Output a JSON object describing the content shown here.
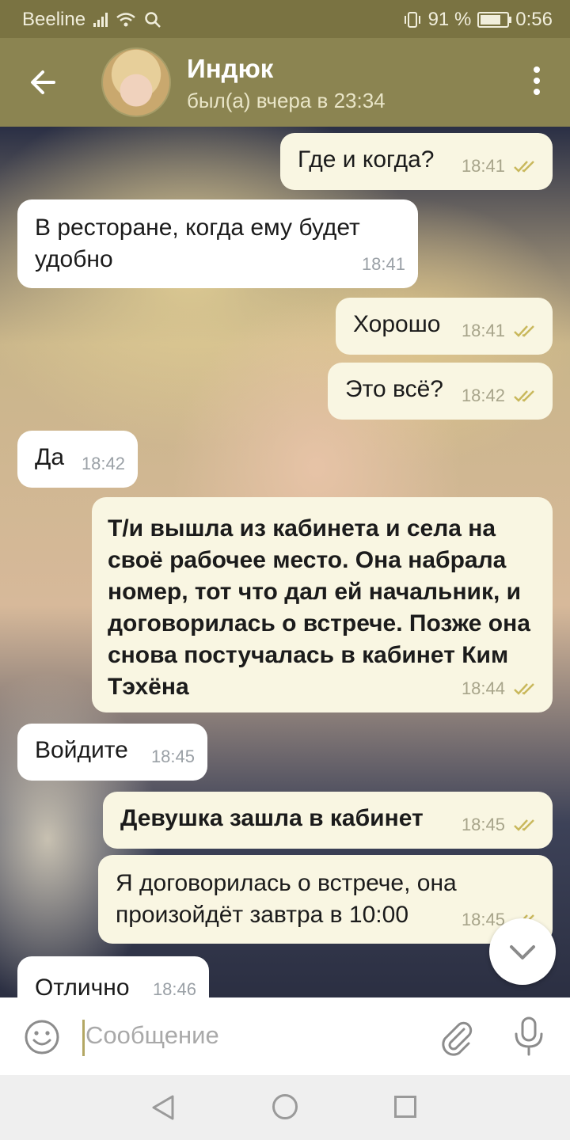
{
  "status_bar": {
    "carrier": "Beeline",
    "battery_percent": "91 %",
    "battery_level": 0.91,
    "time": "0:56"
  },
  "header": {
    "contact_name": "Индюк",
    "last_seen": "был(а) вчера в 23:34"
  },
  "messages": [
    {
      "side": "out",
      "text": "Где и когда?",
      "time": "18:41",
      "status": "read"
    },
    {
      "side": "in",
      "text": "В ресторане, когда ему будет удобно",
      "time": "18:41"
    },
    {
      "side": "out",
      "text": "Хорошо",
      "time": "18:41",
      "status": "read"
    },
    {
      "side": "out",
      "text": "Это всё?",
      "time": "18:42",
      "status": "read"
    },
    {
      "side": "in",
      "text": "Да",
      "time": "18:42"
    },
    {
      "side": "out",
      "text": "Т/и вышла из кабинета и села на своё рабочее место. Она набрала номер, тот что дал ей начальник, и договорилась о встрече. Позже она снова постучалась в кабинет Ким Тэхёна",
      "time": "18:44",
      "status": "read",
      "bold": true
    },
    {
      "side": "in",
      "text": "Войдите",
      "time": "18:45"
    },
    {
      "side": "out",
      "text": "Девушка зашла в кабинет",
      "time": "18:45",
      "status": "read",
      "bold": true
    },
    {
      "side": "out",
      "text": "Я договорилась о встрече, она произойдёт завтра в 10:00",
      "time": "18:45",
      "status": "read"
    },
    {
      "side": "in",
      "text": "Отлично",
      "time": "18:46"
    }
  ],
  "composer": {
    "placeholder": "Сообщение"
  },
  "icons": {
    "back": "arrow-left-icon",
    "menu": "more-vert-icon",
    "emoji": "emoji-icon",
    "attach": "paperclip-icon",
    "mic": "microphone-icon",
    "scroll": "chevron-down-icon"
  },
  "colors": {
    "header": "#8b8451",
    "status_bar": "#7a7342",
    "outgoing_bubble": "#f9f6e2",
    "incoming_bubble": "#ffffff",
    "read_checks": "#c9b85c"
  }
}
